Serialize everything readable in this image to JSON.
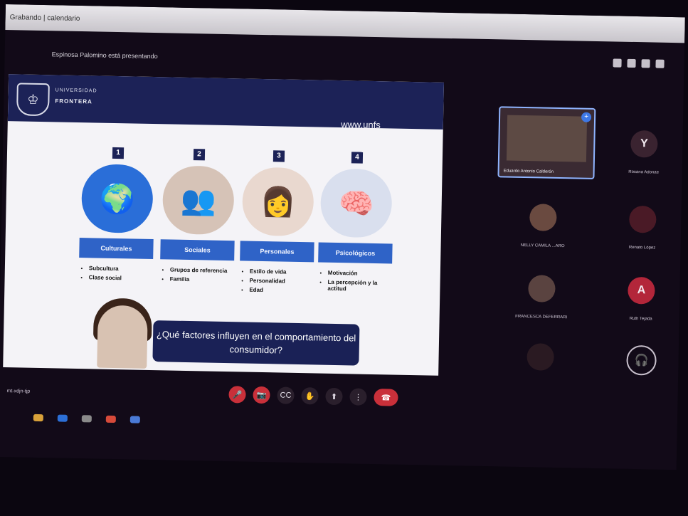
{
  "browser": {
    "tab_title": "Grabando | calendario"
  },
  "presenting_text": "Espinosa Palomino está presentando",
  "slide": {
    "university_top": "UNIVERSIDAD",
    "university_bottom": "FRONTERA",
    "url": "www.unfs",
    "factors": [
      {
        "num": "1",
        "label": "Culturales",
        "items": [
          "Subcultura",
          "Clase social"
        ],
        "color": "#3f6fd1"
      },
      {
        "num": "2",
        "label": "Sociales",
        "items": [
          "Grupos de referencia",
          "Familia"
        ],
        "color": "#b04a3a"
      },
      {
        "num": "3",
        "label": "Personales",
        "items": [
          "Estilo de vida",
          "Personalidad",
          "Edad"
        ],
        "color": "#2f63c7"
      },
      {
        "num": "4",
        "label": "Psicológicos",
        "items": [
          "Motivación",
          "La percepción y la actitud"
        ],
        "color": "#3a5fb0"
      }
    ],
    "question": "¿Qué factores influyen en el comportamiento del consumidor?"
  },
  "participants": [
    {
      "initial": "",
      "name": "Eduardo Antonio Calderón"
    },
    {
      "initial": "Y",
      "name": "Rosana Adonae"
    },
    {
      "initial": "",
      "name": "NELLY CAMILA ...ARO"
    },
    {
      "initial": "",
      "name": "Renato López"
    },
    {
      "initial": "",
      "name": "FRANCESCA DEFERRARI"
    },
    {
      "initial": "A",
      "name": "Ruth Tejada"
    }
  ],
  "meeting_info": "mt-xdjn-tjp",
  "icons": {
    "mic": "mic-off-icon",
    "camera": "camera-off-icon",
    "captions": "captions-icon",
    "hand": "hand-icon",
    "present": "present-icon",
    "more": "more-icon",
    "end": "end-call-icon"
  }
}
